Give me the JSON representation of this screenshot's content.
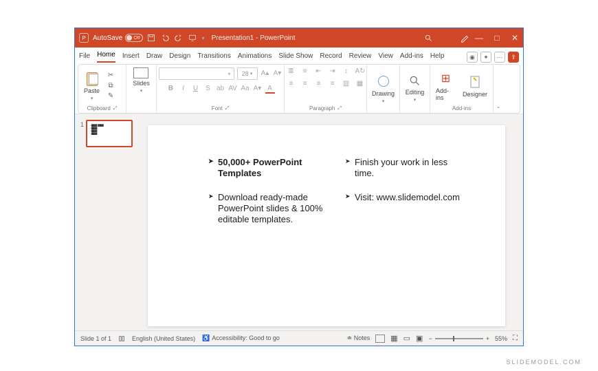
{
  "titlebar": {
    "autosave_label": "AutoSave",
    "autosave_state": "Off",
    "doc_title": "Presentation1 - PowerPoint"
  },
  "tabs": {
    "items": [
      "File",
      "Home",
      "Insert",
      "Draw",
      "Design",
      "Transitions",
      "Animations",
      "Slide Show",
      "Record",
      "Review",
      "View",
      "Add-ins",
      "Help"
    ],
    "active": "Home"
  },
  "ribbon": {
    "clipboard": {
      "paste": "Paste",
      "label": "Clipboard"
    },
    "slides": {
      "slides": "Slides"
    },
    "font": {
      "label": "Font",
      "size_placeholder": "28"
    },
    "paragraph": {
      "label": "Paragraph"
    },
    "drawing": {
      "label": "Drawing"
    },
    "editing": {
      "label": "Editing"
    },
    "addins": {
      "btn": "Add-ins",
      "label": "Add-ins"
    },
    "designer": {
      "btn": "Designer"
    }
  },
  "thumbnails": {
    "num": "1"
  },
  "slide": {
    "col1": [
      {
        "text": "50,000+ PowerPoint Templates",
        "bold": true
      },
      {
        "text": "Download ready-made PowerPoint slides & 100% editable templates.",
        "bold": false
      }
    ],
    "col2": [
      {
        "text": "Finish your work in less time.",
        "bold": false
      },
      {
        "text": "Visit: www.slidemodel.com",
        "bold": false
      }
    ]
  },
  "status": {
    "slide": "Slide 1 of 1",
    "lang": "English (United States)",
    "access": "Accessibility: Good to go",
    "notes": "Notes",
    "zoom": "55%"
  },
  "watermark": "SLIDEMODEL.COM"
}
